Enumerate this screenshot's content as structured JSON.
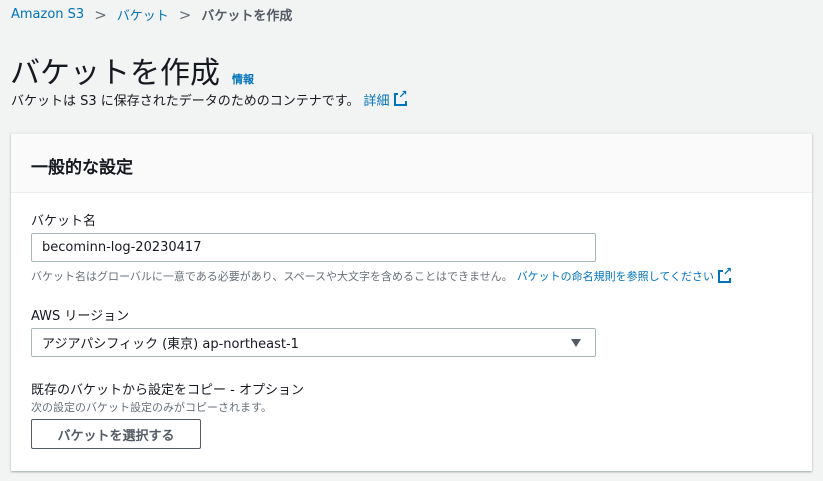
{
  "breadcrumb": {
    "items": [
      "Amazon S3",
      "バケット"
    ],
    "current": "バケットを作成"
  },
  "header": {
    "title": "バケットを作成",
    "info": "情報",
    "description": "バケットは S3 に保存されたデータのためのコンテナです。",
    "details_link": "詳細"
  },
  "panel": {
    "title": "一般的な設定",
    "bucket_name": {
      "label": "バケット名",
      "value": "becominn-log-20230417",
      "hint": "バケット名はグローバルに一意である必要があり、スペースや大文字を含めることはできません。",
      "hint_link": "バケットの命名規則を参照してください"
    },
    "region": {
      "label": "AWS リージョン",
      "value": "アジアパシフィック (東京) ap-northeast-1"
    },
    "copy": {
      "label": "既存のバケットから設定をコピー - オプション",
      "hint": "次の設定のバケット設定のみがコピーされます。",
      "button": "バケットを選択する"
    }
  }
}
